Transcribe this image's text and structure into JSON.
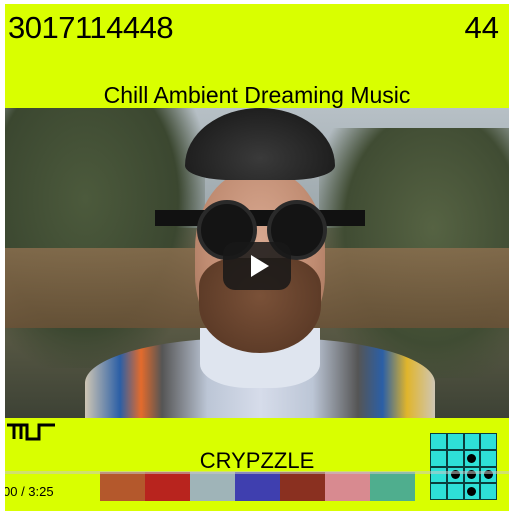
{
  "header": {
    "counter": "3017114448",
    "right_number": "44",
    "title": "Chill Ambient Dreaming Music"
  },
  "video": {
    "play_button_icon": "play-icon",
    "time_label": "00 / 3:25",
    "progress": 0
  },
  "footer": {
    "logo_icon": "brand-logo-icon",
    "brand": "CRYPZZLE",
    "swatches": [
      "#b4582c",
      "#b8241e",
      "#9fb4b8",
      "#3f3faf",
      "#8a3020",
      "#d88a90",
      "#4fae8e"
    ],
    "grid": {
      "icon": "puzzle-grid-icon",
      "dots": [
        [
          0,
          0,
          0,
          0
        ],
        [
          0,
          0,
          1,
          0
        ],
        [
          0,
          1,
          1,
          1
        ],
        [
          0,
          0,
          1,
          0
        ]
      ]
    }
  },
  "colors": {
    "accent": "#d9ff00",
    "grid_fill": "#2ee0d8"
  }
}
